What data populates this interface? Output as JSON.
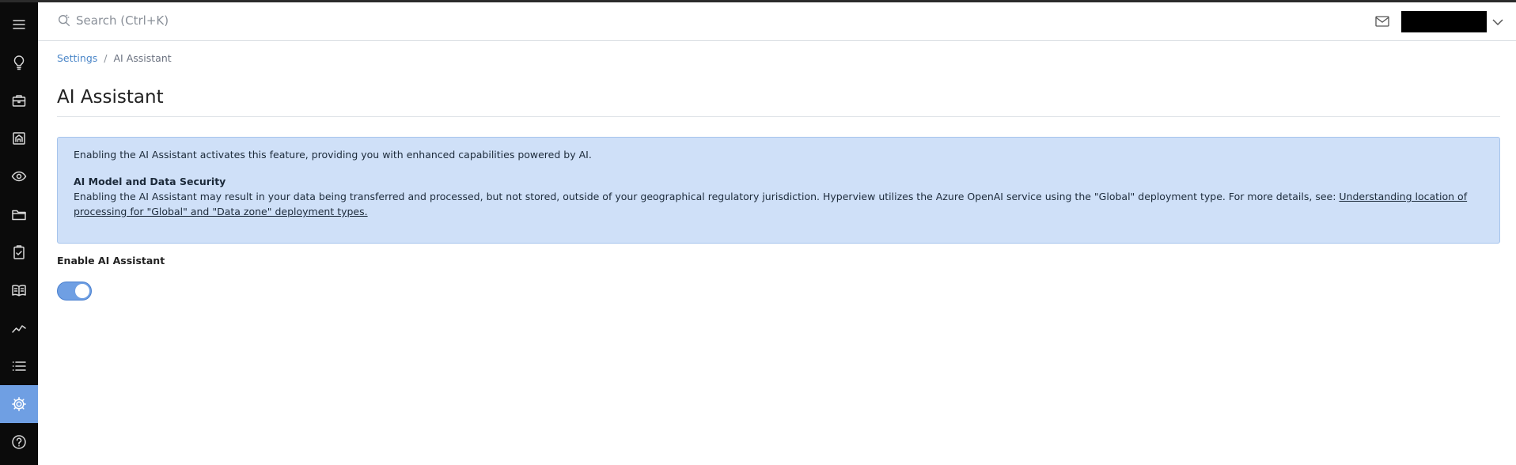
{
  "header": {
    "search_placeholder": "Search (Ctrl+K)"
  },
  "sidebar": {
    "icons": [
      "menu-icon",
      "lightbulb-icon",
      "briefcase-icon",
      "building-icon",
      "eye-icon",
      "folder-icon",
      "clipboard-icon",
      "book-icon",
      "trend-icon",
      "list-icon",
      "gear-icon",
      "help-icon"
    ],
    "active": "gear-icon"
  },
  "breadcrumb": {
    "parent": "Settings",
    "separator": "/",
    "current": "AI Assistant"
  },
  "page": {
    "title": "AI Assistant"
  },
  "info": {
    "intro": "Enabling the AI Assistant activates this feature, providing you with enhanced capabilities powered by AI.",
    "heading": "AI Model and Data Security",
    "body": "Enabling the AI Assistant may result in your data being transferred and processed, but not stored, outside of your geographical regulatory jurisdiction. Hyperview utilizes the Azure OpenAI service using the \"Global\" deployment type. For more details, see: ",
    "link": "Understanding location of processing for \"Global\" and \"Data zone\" deployment types."
  },
  "setting": {
    "label": "Enable AI Assistant",
    "enabled": true
  },
  "colors": {
    "accent": "#6f9fe3",
    "info_bg": "#cfe0f8",
    "link": "#4a86c8"
  }
}
